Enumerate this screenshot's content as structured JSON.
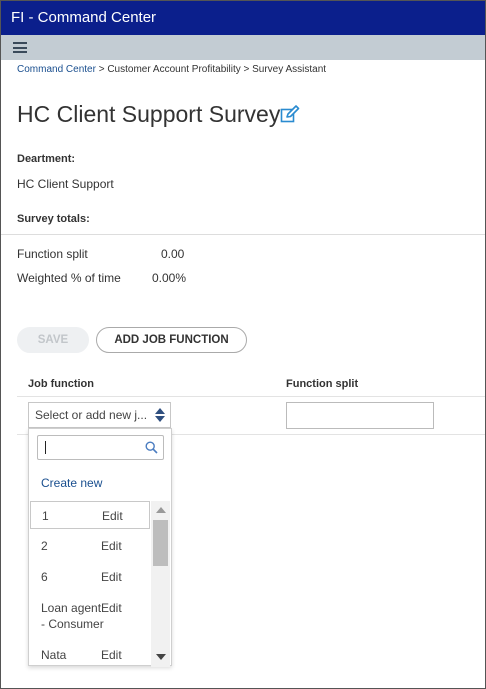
{
  "app": {
    "title": "FI - Command Center"
  },
  "breadcrumb": {
    "items": [
      "Command Center",
      "Customer Account Profitability",
      "Survey Assistant"
    ],
    "separator": ">"
  },
  "page": {
    "title": "HC Client Support Survey"
  },
  "department": {
    "label": "Deartment:",
    "value": "HC Client Support"
  },
  "totals": {
    "label": "Survey totals:",
    "function_split_label": "Function split",
    "function_split_value": "0.00",
    "weighted_label": "Weighted % of time",
    "weighted_value": "0.00%"
  },
  "actions": {
    "save_label": "SAVE",
    "add_label": "ADD JOB FUNCTION"
  },
  "table": {
    "columns": [
      "Job function",
      "Function split"
    ],
    "select_placeholder": "Select or add new j...",
    "dropdown": {
      "search_value": "",
      "create_new_label": "Create new",
      "items": [
        {
          "name": "1",
          "edit": "Edit"
        },
        {
          "name": "2",
          "edit": "Edit"
        },
        {
          "name": "6",
          "edit": "Edit"
        },
        {
          "name_line1": "Loan agent",
          "name_line2": "- Consumer",
          "edit": "Edit"
        },
        {
          "name": "Nata",
          "edit": "Edit"
        }
      ]
    }
  },
  "colors": {
    "titlebar": "#0b1f8c",
    "toolbar": "#c3ccd3",
    "link": "#1a4f8f",
    "edit_icon": "#2a8bd0"
  },
  "icons": [
    "hamburger-icon",
    "edit-icon",
    "sort-arrows-icon",
    "search-icon",
    "scroll-up-icon",
    "scroll-down-icon"
  ]
}
